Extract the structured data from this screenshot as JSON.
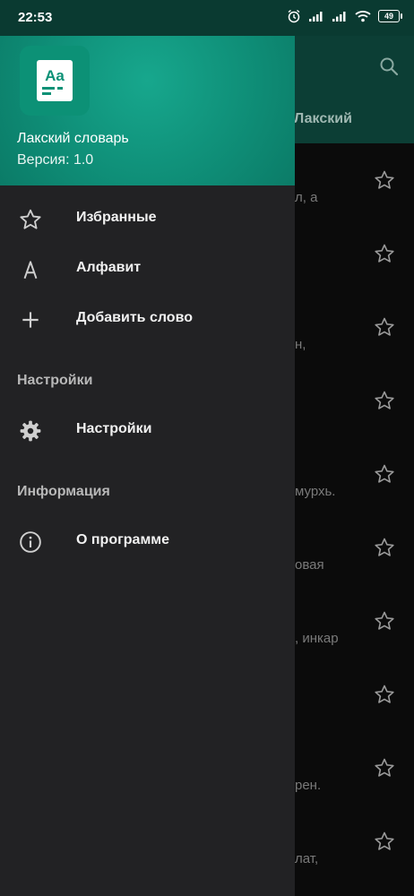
{
  "status_bar": {
    "time": "22:53",
    "battery": "49"
  },
  "background": {
    "tab_label": "Лакский",
    "rows": [
      {
        "snippet": "л, а"
      },
      {
        "snippet": ""
      },
      {
        "snippet": "н,"
      },
      {
        "snippet": ""
      },
      {
        "snippet": "мурхь."
      },
      {
        "snippet": "овая"
      },
      {
        "snippet": ", инкар"
      },
      {
        "snippet": ""
      },
      {
        "snippet": "рен."
      },
      {
        "snippet": "лат,"
      }
    ]
  },
  "drawer": {
    "header": {
      "app_name": "Лакский словарь",
      "version": "Версия: 1.0",
      "icon_text": "Aa"
    },
    "items": [
      {
        "label": "Избранные",
        "icon": "star-outline-icon"
      },
      {
        "label": "Алфавит",
        "icon": "letter-a-icon",
        "glyph": "A"
      },
      {
        "label": "Добавить слово",
        "icon": "plus-icon"
      }
    ],
    "section_settings": "Настройки",
    "settings_item": {
      "label": "Настройки",
      "icon": "gear-icon"
    },
    "section_info": "Информация",
    "about_item": {
      "label": "О программе",
      "icon": "info-icon"
    }
  },
  "colors": {
    "accent": "#0f8f78",
    "drawer_bg": "#222224",
    "background": "#0b0b0b"
  }
}
